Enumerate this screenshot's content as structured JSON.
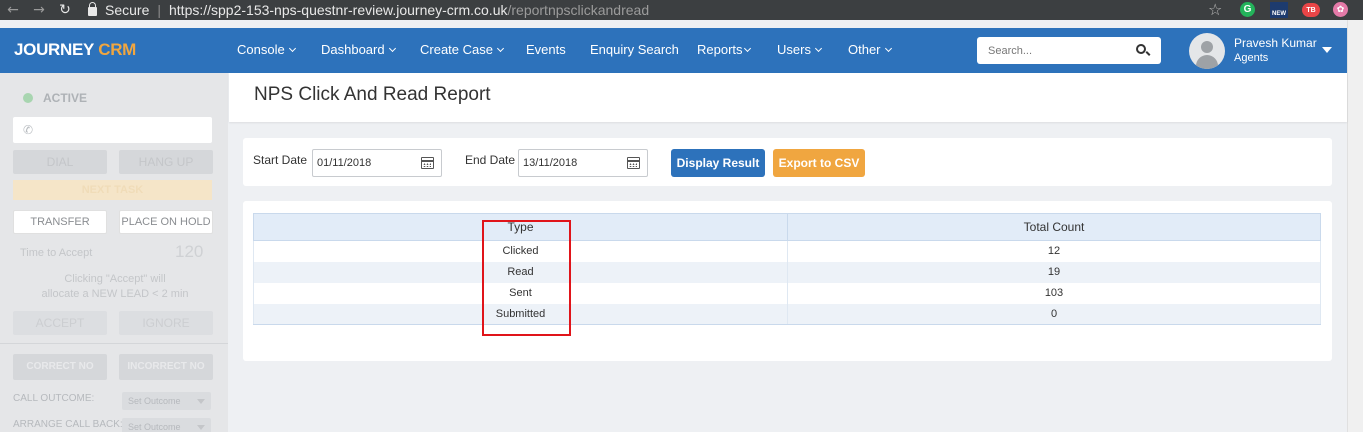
{
  "browser": {
    "secure_label": "Secure",
    "url_host": "https://spp2-153-nps-questnr-review.journey-crm.co.uk",
    "url_path": "/reportnpsclickandread",
    "extensions": [
      "G",
      "NEW",
      "TB",
      "✿"
    ]
  },
  "header": {
    "logo_main": "JOURNEY",
    "logo_accent": "CRM",
    "nav": [
      "Console",
      "Dashboard",
      "Create Case",
      "Events",
      "Enquiry Search",
      "Reports",
      "Users",
      "Other"
    ],
    "search_placeholder": "Search...",
    "user_name": "Pravesh Kumar",
    "user_role": "Agents"
  },
  "sidebar": {
    "status": "ACTIVE",
    "dial": "DIAL",
    "hang_up": "HANG UP",
    "next_task": "NEXT TASK",
    "transfer": "TRANSFER",
    "place_on_hold": "PLACE ON HOLD",
    "time_to_accept_label": "Time to Accept",
    "time_to_accept_value": "120",
    "info_line1": "Clicking \"Accept\" will",
    "info_line2": "allocate a NEW LEAD < 2 min",
    "accept": "ACCEPT",
    "ignore": "IGNORE",
    "correct_no": "CORRECT NO",
    "incorrect_no": "INCORRECT NO",
    "call_outcome_label": "CALL OUTCOME:",
    "call_outcome_value": "Set Outcome",
    "arrange_call_back_label": "ARRANGE CALL BACK:",
    "arrange_call_back_value": "Set Outcome"
  },
  "page": {
    "title": "NPS Click And Read Report"
  },
  "filters": {
    "start_label": "Start Date",
    "start_value": "01/11/2018",
    "end_label": "End Date",
    "end_value": "13/11/2018",
    "display_button": "Display Result",
    "export_button": "Export to CSV"
  },
  "table": {
    "headers": [
      "Type",
      "Total Count"
    ],
    "rows": [
      {
        "type": "Clicked",
        "count": "12"
      },
      {
        "type": "Read",
        "count": "19"
      },
      {
        "type": "Sent",
        "count": "103"
      },
      {
        "type": "Submitted",
        "count": "0"
      }
    ]
  },
  "colors": {
    "brand_blue": "#2d72bb",
    "brand_orange": "#f0a640",
    "highlight_red": "#e0141a"
  }
}
